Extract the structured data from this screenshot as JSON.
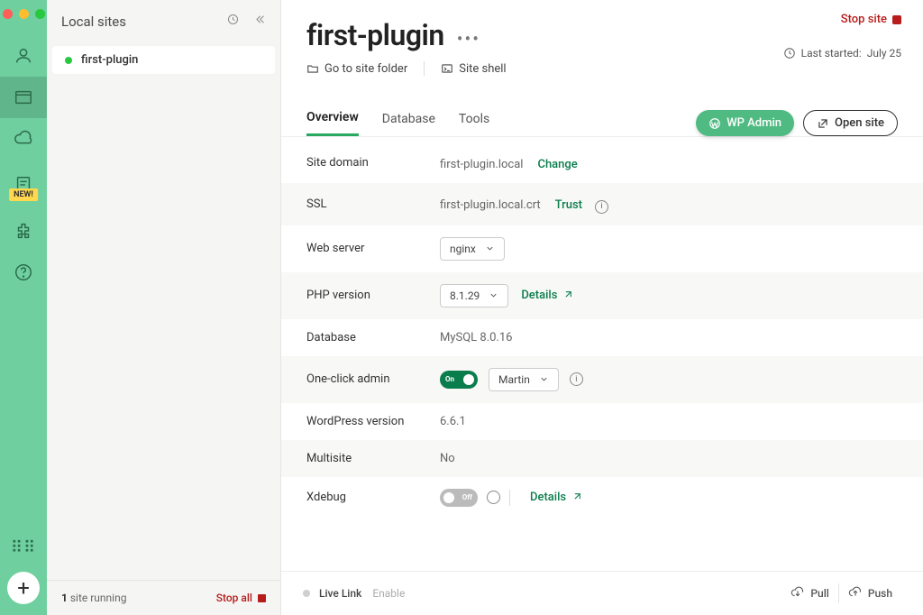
{
  "sidebar": {
    "title": "Local sites",
    "sites": [
      {
        "name": "first-plugin",
        "status": "running"
      }
    ],
    "footer": {
      "count_prefix": "1",
      "count_label": " site running",
      "stop_all": "Stop all"
    }
  },
  "rail": {
    "new_badge": "NEW!"
  },
  "main": {
    "title": "first-plugin",
    "stop_site": "Stop site",
    "last_started_label": "Last started: ",
    "last_started_value": "July 25",
    "go_to_folder": "Go to site folder",
    "site_shell": "Site shell",
    "tabs": {
      "overview": "Overview",
      "database": "Database",
      "tools": "Tools"
    },
    "wp_admin": "WP Admin",
    "open_site": "Open site"
  },
  "overview": {
    "rows": {
      "site_domain": {
        "label": "Site domain",
        "value": "first-plugin.local",
        "action": "Change"
      },
      "ssl": {
        "label": "SSL",
        "value": "first-plugin.local.crt",
        "action": "Trust"
      },
      "web_server": {
        "label": "Web server",
        "value": "nginx"
      },
      "php": {
        "label": "PHP version",
        "value": "8.1.29",
        "action": "Details"
      },
      "database": {
        "label": "Database",
        "value": "MySQL 8.0.16"
      },
      "oneclick": {
        "label": "One-click admin",
        "toggle": "On",
        "user": "Martin"
      },
      "wp_version": {
        "label": "WordPress version",
        "value": "6.6.1"
      },
      "multisite": {
        "label": "Multisite",
        "value": "No"
      },
      "xdebug": {
        "label": "Xdebug",
        "toggle": "Off",
        "action": "Details"
      }
    }
  },
  "footer": {
    "live_link": "Live Link",
    "enable": "Enable",
    "pull": "Pull",
    "push": "Push"
  }
}
